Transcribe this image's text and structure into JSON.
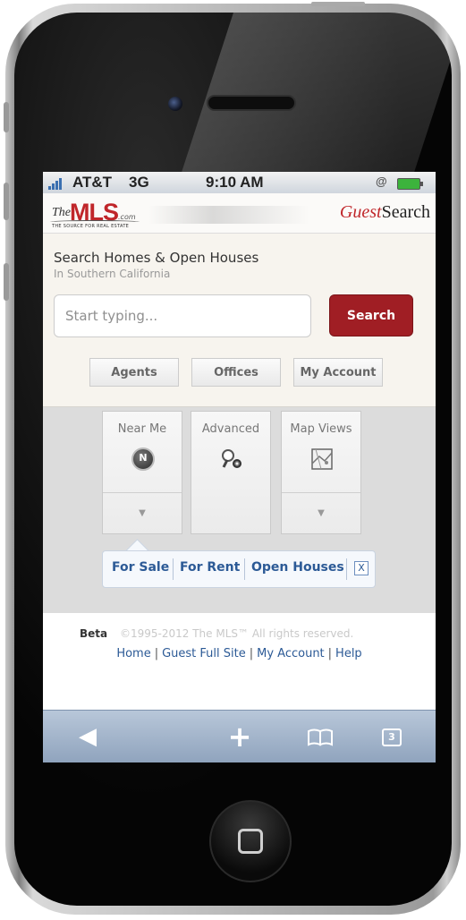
{
  "status_bar": {
    "carrier": "AT&T",
    "network": "3G",
    "time": "9:10 AM"
  },
  "header": {
    "logo": {
      "the": "The",
      "mls": "MLS",
      "com": ".com",
      "tagline": "THE SOURCE FOR REAL ESTATE"
    },
    "guest_prefix": "Guest",
    "guest_suffix": "Search"
  },
  "search": {
    "headline": "Search Homes & Open Houses",
    "subline": "In Southern California",
    "placeholder": "Start typing...",
    "button_label": "Search"
  },
  "quick_links": [
    {
      "label": "Agents"
    },
    {
      "label": "Offices"
    },
    {
      "label": "My Account"
    }
  ],
  "tiles": [
    {
      "label": "Near Me",
      "icon": "compass-icon",
      "compass_letter": "N"
    },
    {
      "label": "Advanced",
      "icon": "magnifier-gear-icon"
    },
    {
      "label": "Map Views",
      "icon": "map-icon"
    }
  ],
  "filters": {
    "items": [
      "For Sale",
      "For Rent",
      "Open Houses"
    ],
    "close": "X"
  },
  "footer": {
    "beta": "Beta",
    "copyright": "©1995-2012 The MLS™ All rights reserved.",
    "links": [
      "Home",
      "Guest Full Site",
      "My Account",
      "Help"
    ]
  },
  "toolbar": {
    "tabs_count": "3"
  },
  "colors": {
    "brand_red": "#a01e24",
    "link_blue": "#2c5a96"
  }
}
